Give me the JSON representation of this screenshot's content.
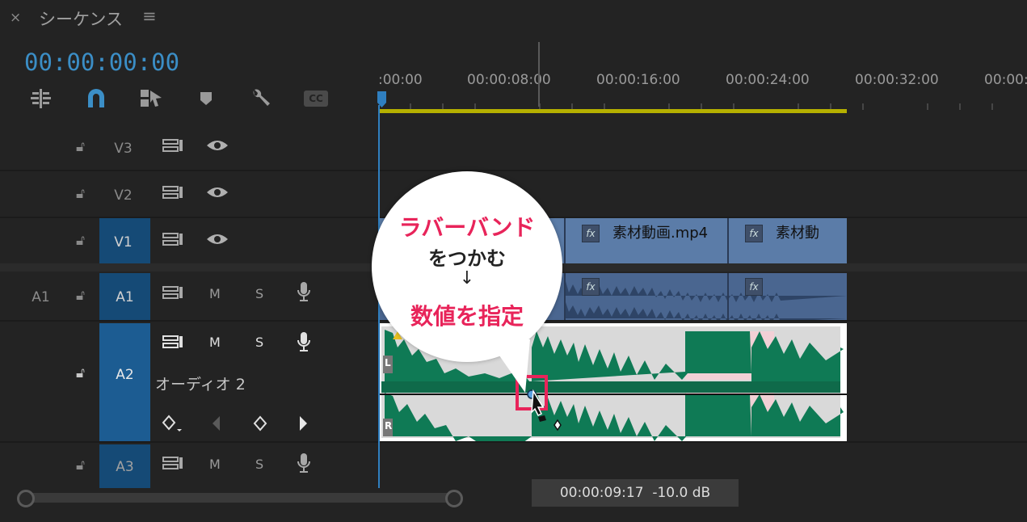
{
  "panel": {
    "close_glyph": "×",
    "title": "シーケンス",
    "menu_glyph": "≡",
    "timecode": "00:00:00:00"
  },
  "toolbar": {
    "icons": [
      "insert-nest-icon",
      "snap-magnet-icon",
      "linked-selection-icon",
      "add-marker-icon",
      "timeline-settings-wrench-icon",
      "captions-cc-icon"
    ],
    "cc_label": "CC"
  },
  "ruler": {
    "ticks": [
      ":00:00",
      "00:00:08:00",
      "00:00:16:00",
      "00:00:24:00",
      "00:00:32:00",
      "00:00:"
    ]
  },
  "tracks": {
    "v3": {
      "label": "V3"
    },
    "v2": {
      "label": "V2"
    },
    "v1": {
      "label": "V1"
    },
    "a1": {
      "source": "A1",
      "label": "A1",
      "mute": "M",
      "solo": "S"
    },
    "a2": {
      "label": "A2",
      "name": "オーディオ 2",
      "mute": "M",
      "solo": "S"
    },
    "a3": {
      "label": "A3",
      "mute": "M",
      "solo": "S"
    }
  },
  "clips": {
    "v1_clip2": "素材動画.mp4",
    "v1_clip3": "素材動",
    "fx": "fx",
    "channel_l": "L",
    "channel_r": "R"
  },
  "callout": {
    "line1": "ラバーバンド",
    "line2": "をつかむ",
    "arrow": "↓",
    "line3": "数値を指定"
  },
  "tooltip": {
    "time": "00:00:09:17",
    "value": "-10.0 dB"
  },
  "colors": {
    "accent_blue": "#3b8ec6",
    "selected_track": "#1c5c92",
    "video_clip": "#5b7ca8",
    "audio_wave": "#0f7a55",
    "callout_pink": "#e8245a",
    "highlight_box": "#e8245a",
    "work_area_bar": "#b5b000"
  }
}
